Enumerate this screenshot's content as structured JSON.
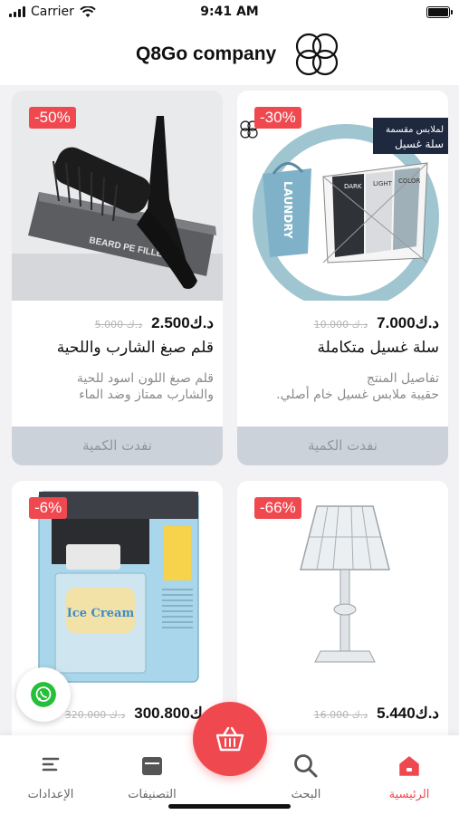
{
  "status_bar": {
    "carrier": "Carrier",
    "time": "9:41 AM"
  },
  "header": {
    "company_name": "Q8Go company"
  },
  "products": [
    {
      "discount": "-50%",
      "new_price": "2.500د.ك",
      "old_price": "5.000 د.ك",
      "title": "قلم صبغ الشارب واللحية",
      "desc_line1": "قلم صبغ اللون اسود للحية",
      "desc_line2": "والشارب ممتاز وضد الماء",
      "status": "نفدت الكمية",
      "image_text": "BEARD PE FILLER"
    },
    {
      "discount": "-30%",
      "new_price": "7.000د.ك",
      "old_price": "10.000 د.ك",
      "title": "سلة غسيل متكاملة",
      "desc_line1": "تفاصيل المنتج",
      "desc_line2": "حقيبة ملابس غسيل خام أصلي.",
      "status": "نفدت الكمية",
      "image_banner_line1": "لملابس مقسمة",
      "image_banner_line2": "سلة غسيل",
      "image_bag_text": "LAUNDRY",
      "image_labels": [
        "DARK",
        "LIGHT",
        "COLOR"
      ]
    },
    {
      "discount": "-6%",
      "new_price": "300.800د.ك",
      "old_price": "320.000 د.ك",
      "image_text": "Ice Cream"
    },
    {
      "discount": "-66%",
      "new_price": "5.440د.ك",
      "old_price": "16.000 د.ك"
    }
  ],
  "bottom_nav": {
    "home": "الرئيسية",
    "search": "البحث",
    "categories": "التصنيفات",
    "settings": "الإعدادات"
  },
  "icons": {
    "whatsapp": "whatsapp-icon",
    "cart": "basket-icon",
    "home": "home-icon",
    "search": "search-icon",
    "categories": "categories-icon",
    "settings": "menu-lines-icon"
  },
  "colors": {
    "accent": "#f0484f",
    "soldout_bg": "#ccd2da",
    "whatsapp": "#26bf3a"
  }
}
